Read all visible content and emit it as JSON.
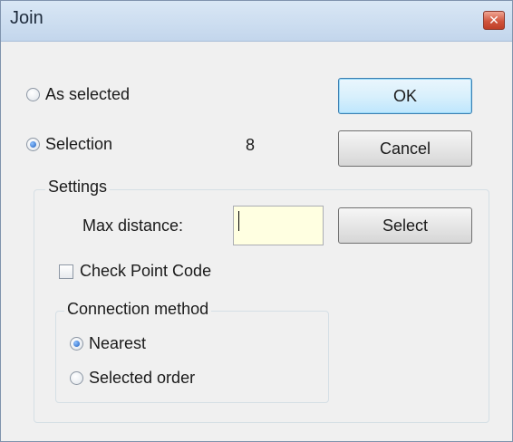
{
  "window": {
    "title": "Join",
    "close_glyph": "✕"
  },
  "selection_options": {
    "as_selected_label": "As selected",
    "selection_label": "Selection",
    "selection_count": "8",
    "selected": "selection"
  },
  "buttons": {
    "ok_label": "OK",
    "cancel_label": "Cancel",
    "select_label": "Select"
  },
  "settings": {
    "group_label": "Settings",
    "max_distance_label": "Max distance:",
    "max_distance_value": "",
    "check_point_code_label": "Check Point Code",
    "check_point_code_checked": false
  },
  "connection_method": {
    "group_label": "Connection method",
    "nearest_label": "Nearest",
    "selected_order_label": "Selected order",
    "selected": "nearest"
  },
  "colors": {
    "input_background": "#ffffe1",
    "default_button_border": "#3c7fb1",
    "close_button": "#c94b35"
  }
}
